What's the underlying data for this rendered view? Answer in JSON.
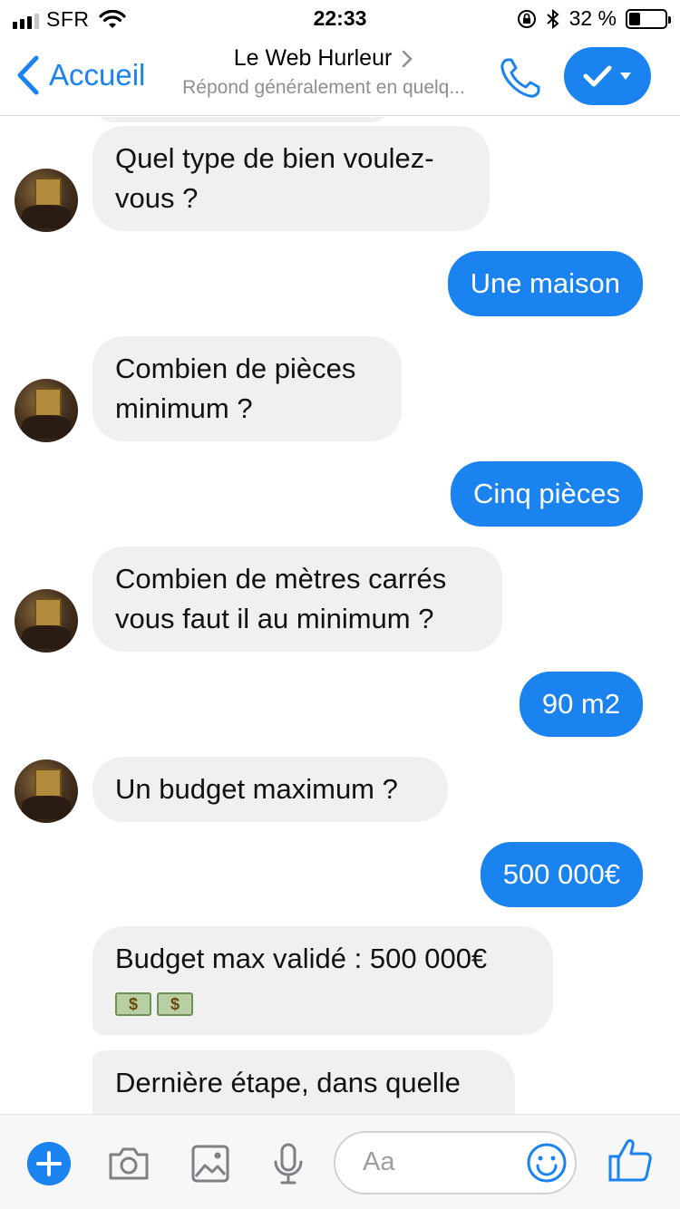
{
  "status_bar": {
    "carrier": "SFR",
    "time": "22:33",
    "battery": "32 %",
    "battery_level": 0.32
  },
  "nav": {
    "back_label": "Accueil",
    "title": "Le Web Hurleur",
    "subtitle": "Répond généralement en quelq..."
  },
  "colors": {
    "accent": "#1a83f0",
    "incoming_bubble": "#f0f0f0"
  },
  "messages": [
    {
      "from": "bot",
      "lines": [
        "Quel type de bien voulez-",
        "vous ?"
      ]
    },
    {
      "from": "me",
      "text": "Une maison"
    },
    {
      "from": "bot",
      "lines": [
        "Combien de pièces",
        "minimum ?"
      ]
    },
    {
      "from": "me",
      "text": "Cinq pièces"
    },
    {
      "from": "bot",
      "lines": [
        "Combien de mètres carrés",
        "vous faut il au minimum ?"
      ]
    },
    {
      "from": "me",
      "text": "90 m2"
    },
    {
      "from": "bot",
      "lines": [
        "Un budget maximum ?"
      ]
    },
    {
      "from": "me",
      "text": "500 000€"
    },
    {
      "from": "bot",
      "lines": [
        "Budget max validé : 500 000€"
      ],
      "emoji": "money-bag-icon money-bag-icon"
    },
    {
      "from": "bot",
      "lines": [
        "Dernière étape, dans quelle"
      ]
    }
  ],
  "composer": {
    "placeholder": "Aa",
    "icons": [
      "plus-icon",
      "camera-icon",
      "image-icon",
      "microphone-icon",
      "smiley-icon",
      "thumbs-up-icon"
    ]
  }
}
